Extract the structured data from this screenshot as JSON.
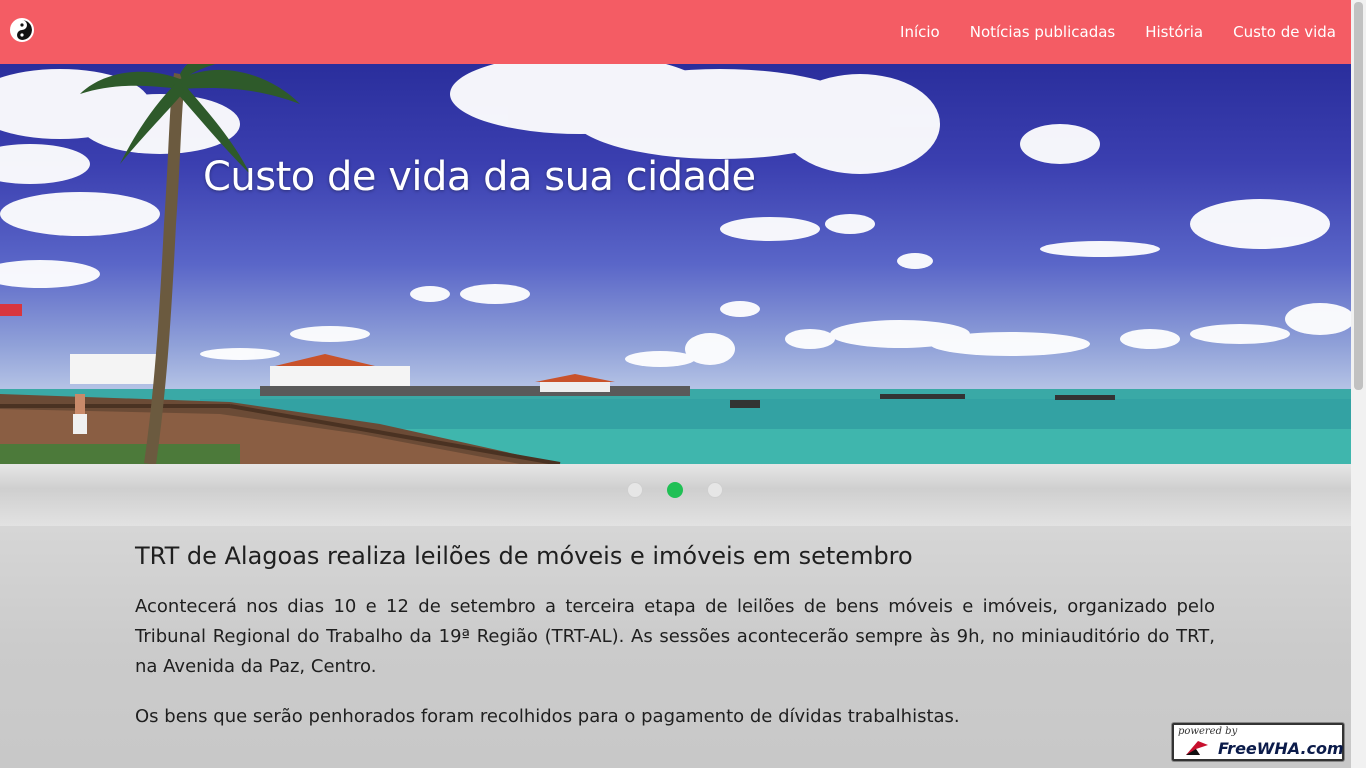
{
  "header": {
    "logo_icon": "yin-yang-icon",
    "nav": [
      {
        "label": "Início"
      },
      {
        "label": "Notícias publicadas"
      },
      {
        "label": "História"
      },
      {
        "label": "Custo de vida"
      }
    ],
    "bg_color": "#f45c64"
  },
  "hero": {
    "title": "Custo de vida da sua cidade",
    "carousel": {
      "count": 3,
      "active": 2,
      "active_color": "#20c055"
    }
  },
  "article": {
    "title": "TRT de Alagoas realiza leilões de móveis e imóveis em setembro",
    "paragraphs": [
      "Acontecerá nos dias 10 e 12 de setembro a terceira etapa de leilões de bens móveis e imóveis, organizado pelo Tribunal Regional do Trabalho da 19ª Região (TRT-AL). As sessões acontecerão sempre às 9h, no miniauditório do TRT, na Avenida da Paz, Centro.",
      "Os bens que serão penhorados foram recolhidos para o pagamento de dívidas trabalhistas."
    ]
  },
  "badge": {
    "small": "powered by",
    "big": "FreeWHA.com"
  }
}
